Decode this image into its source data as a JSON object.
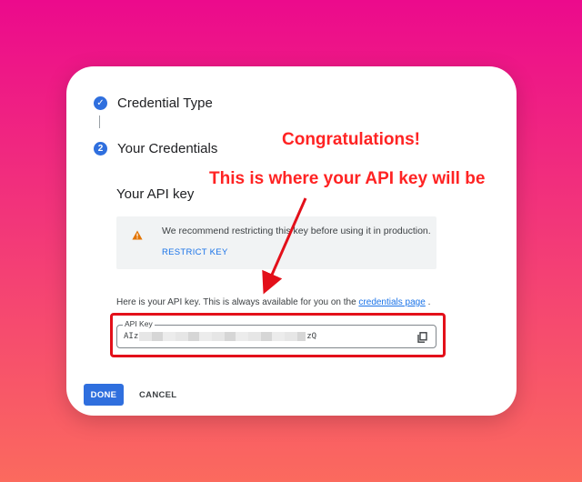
{
  "steps": [
    {
      "number": "✓",
      "label": "Credential Type"
    },
    {
      "number": "2",
      "label": "Your Credentials"
    }
  ],
  "section_title": "Your API key",
  "warning": {
    "text": "We recommend restricting this key before using it in production.",
    "link_label": "RESTRICT KEY"
  },
  "info": {
    "prefix": "Here is your API key. This is always available for you on the ",
    "link": "credentials page",
    "suffix": " ."
  },
  "api_key": {
    "label": "API Key",
    "value_start": "AIz",
    "value_end": "zQ"
  },
  "actions": {
    "done_label": "DONE",
    "cancel_label": "CANCEL"
  },
  "annotations": {
    "line1": "Congratulations!",
    "line2": "This is where your API key will be"
  },
  "colors": {
    "accent": "#2f6fde",
    "annotation_red": "#e3101a",
    "warning_amber": "#e37400"
  },
  "icons": {
    "copy": "copy-icon",
    "warning": "warning-icon",
    "check": "check-icon"
  }
}
